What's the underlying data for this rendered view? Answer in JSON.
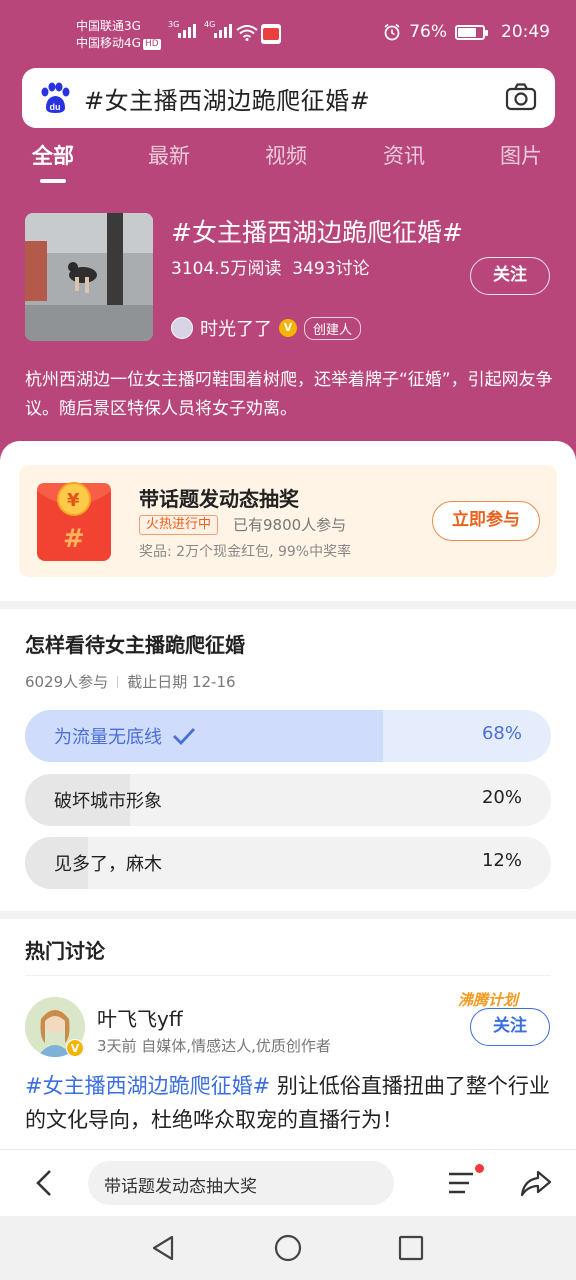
{
  "status_bar": {
    "carrier1": "中国联通3G",
    "carrier2": "中国移动4G",
    "hd": "HD",
    "net1": "3G",
    "net2": "4G",
    "battery_pct": "76%",
    "battery_level": 0.76,
    "time": "20:49"
  },
  "search": {
    "query": "#女主播西湖边跪爬征婚#"
  },
  "tabs": [
    "全部",
    "最新",
    "视频",
    "资讯",
    "图片"
  ],
  "topic": {
    "title": "#女主播西湖边跪爬征婚#",
    "reads": "3104.5万阅读",
    "discussions": "3493讨论",
    "follow": "关注",
    "creator_name": "时光了了",
    "creator_tag": "创建人",
    "description": "杭州西湖边一位女主播叼鞋围着树爬，还举着牌子“征婚”，引起网友争议。随后景区特保人员将女子劝离。"
  },
  "promo": {
    "title": "带话题发动态抽奖",
    "hot_tag": "火热进行中",
    "joined": "已有9800人参与",
    "prize": "奖品: 2万个现金红包, 99%中奖率",
    "button": "立即参与"
  },
  "poll": {
    "title": "怎样看待女主播跪爬征婚",
    "participants": "6029人参与",
    "deadline": "截止日期 12-16",
    "options": [
      {
        "label": "为流量无底线",
        "pct": "68%",
        "value": 0.68,
        "selected": true
      },
      {
        "label": "破坏城市形象",
        "pct": "20%",
        "value": 0.2,
        "selected": false
      },
      {
        "label": "见多了，麻木",
        "pct": "12%",
        "value": 0.12,
        "selected": false
      }
    ]
  },
  "hot_discussion": {
    "title": "热门讨论",
    "post": {
      "author": "叶飞飞yff",
      "meta": "3天前  自媒体,情感达人,优质创作者",
      "badge": "沸腾计划",
      "follow": "关注",
      "hashtag": "#女主播西湖边跪爬征婚#",
      "text": " 别让低俗直播扭曲了整个行业的文化导向，杜绝哗众取宠的直播行为！"
    }
  },
  "bottom_bar": {
    "input_text": "带话题发动态抽大奖"
  },
  "colors": {
    "header": "#b8467a",
    "accent_blue": "#3b6ee0",
    "accent_orange": "#e9621c"
  }
}
